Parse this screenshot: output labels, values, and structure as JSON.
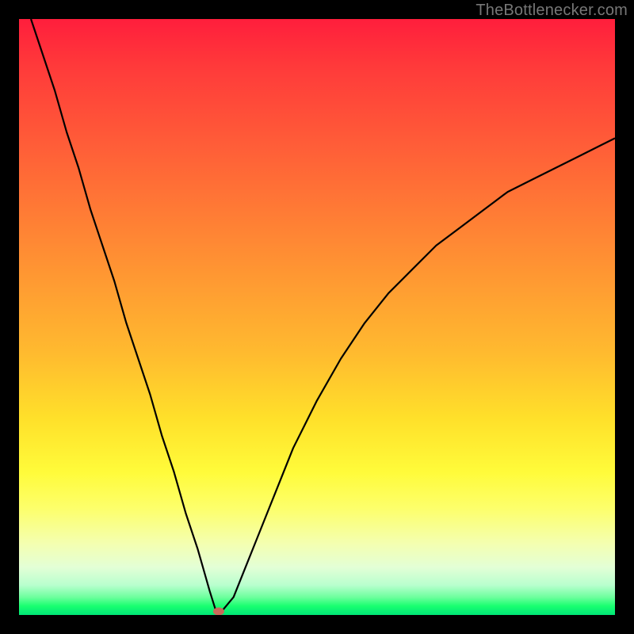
{
  "watermark": "TheBottlenecker.com",
  "chart_data": {
    "type": "line",
    "title": "",
    "xlabel": "",
    "ylabel": "",
    "xlim": [
      0,
      100
    ],
    "ylim": [
      0,
      100
    ],
    "x": [
      2,
      4,
      6,
      8,
      10,
      12,
      14,
      16,
      18,
      20,
      22,
      24,
      26,
      28,
      30,
      32,
      33,
      34,
      36,
      38,
      40,
      42,
      44,
      46,
      48,
      50,
      54,
      58,
      62,
      66,
      70,
      74,
      78,
      82,
      86,
      90,
      94,
      98,
      100
    ],
    "y": [
      100,
      94,
      88,
      81,
      75,
      68,
      62,
      56,
      49,
      43,
      37,
      30,
      24,
      17,
      11,
      4,
      0.8,
      0.6,
      3,
      8,
      13,
      18,
      23,
      28,
      32,
      36,
      43,
      49,
      54,
      58,
      62,
      65,
      68,
      71,
      73,
      75,
      77,
      79,
      80
    ],
    "minimum_marker": {
      "x": 33.5,
      "y": 0.6
    },
    "background_gradient": {
      "top": "#ff1e3c",
      "mid": "#ffe02a",
      "bottom": "#00e676"
    }
  }
}
